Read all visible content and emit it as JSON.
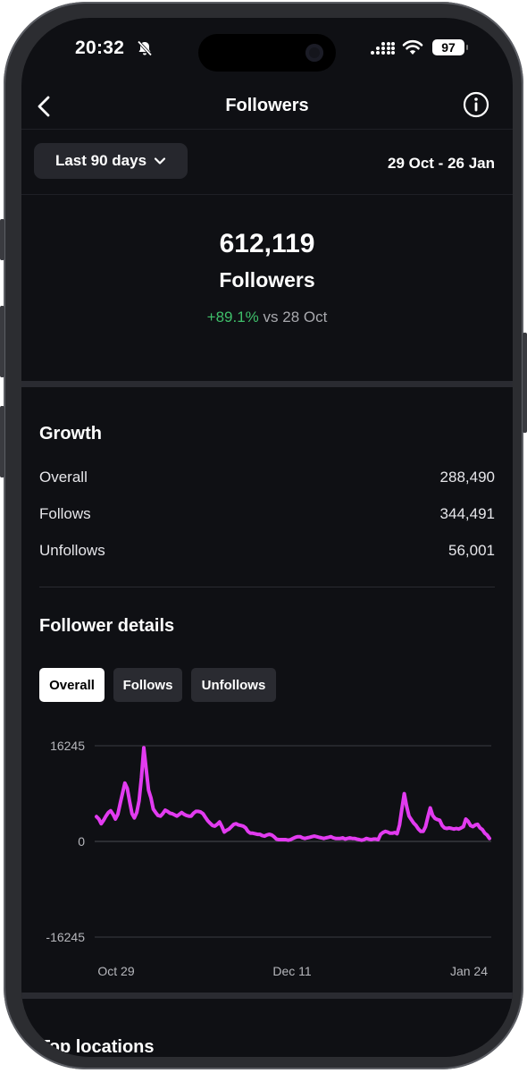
{
  "status_bar": {
    "time": "20:32",
    "battery": "97"
  },
  "header": {
    "title": "Followers"
  },
  "filter": {
    "range_label": "Last 90 days",
    "date_range": "29 Oct - 26 Jan"
  },
  "summary": {
    "count": "612,119",
    "label": "Followers",
    "change": "+89.1%",
    "compare": "vs 28 Oct"
  },
  "growth": {
    "title": "Growth",
    "rows": [
      {
        "label": "Overall",
        "value": "288,490"
      },
      {
        "label": "Follows",
        "value": "344,491"
      },
      {
        "label": "Unfollows",
        "value": "56,001"
      }
    ]
  },
  "details": {
    "title": "Follower details",
    "tabs": [
      "Overall",
      "Follows",
      "Unfollows"
    ],
    "active_tab": "Overall"
  },
  "next_section": {
    "title": "Top locations"
  },
  "chart_data": {
    "type": "line",
    "y_ticks": [
      "16245",
      "0",
      "-16245"
    ],
    "ylim": [
      -16245,
      16245
    ],
    "x_ticks": [
      "Oct 29",
      "Dec 11",
      "Jan 24"
    ],
    "series": [
      {
        "color": "#e23bf0",
        "values": [
          4200,
          3800,
          3000,
          3600,
          4300,
          4900,
          5200,
          4600,
          3800,
          4600,
          6400,
          8200,
          9900,
          9000,
          6800,
          4700,
          4000,
          4900,
          6900,
          10900,
          15900,
          12200,
          8700,
          7400,
          5500,
          4900,
          4400,
          4300,
          4700,
          5300,
          5100,
          4800,
          4700,
          4500,
          4300,
          4600,
          4900,
          4600,
          4400,
          4300,
          4300,
          4800,
          5100,
          5100,
          5000,
          4700,
          4100,
          3500,
          3100,
          2700,
          2600,
          2900,
          3300,
          2500,
          1600,
          1900,
          2100,
          2500,
          2900,
          3000,
          2800,
          2700,
          2600,
          2300,
          1700,
          1400,
          1400,
          1300,
          1200,
          1200,
          1000,
          900,
          1100,
          1200,
          1100,
          800,
          400,
          300,
          300,
          300,
          300,
          200,
          300,
          500,
          700,
          800,
          800,
          600,
          500,
          600,
          700,
          800,
          900,
          800,
          700,
          600,
          500,
          600,
          700,
          800,
          600,
          500,
          500,
          500,
          600,
          400,
          500,
          600,
          500,
          500,
          400,
          300,
          200,
          300,
          500,
          400,
          300,
          400,
          400,
          300,
          1200,
          1500,
          1700,
          1600,
          1400,
          1400,
          1500,
          1300,
          2800,
          5500,
          8100,
          6000,
          4300,
          3700,
          3100,
          2700,
          2100,
          1700,
          1700,
          2500,
          4200,
          5700,
          4400,
          3900,
          3700,
          3600,
          2700,
          2300,
          2200,
          2300,
          2200,
          2100,
          2200,
          2100,
          2300,
          2500,
          3800,
          3400,
          2700,
          2500,
          2800,
          2900,
          2300,
          2000,
          1400,
          1100,
          500
        ]
      }
    ]
  }
}
